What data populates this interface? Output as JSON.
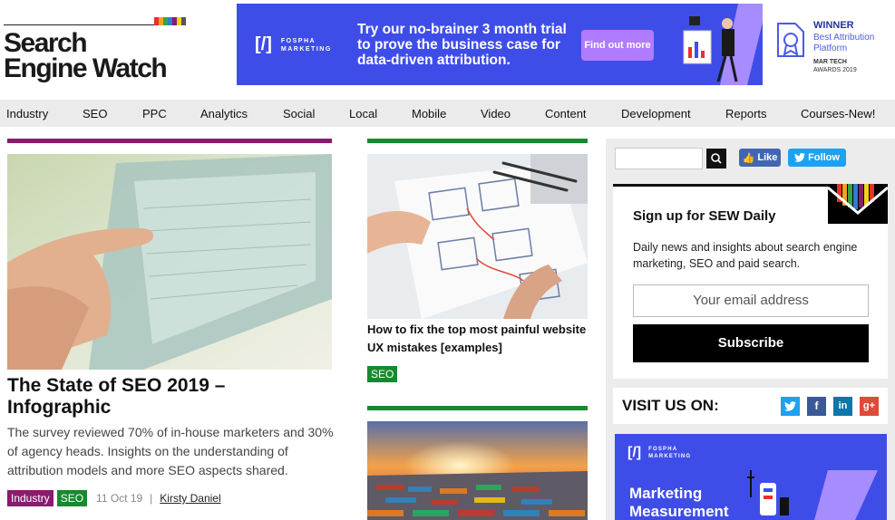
{
  "logo": {
    "line1": "Search",
    "line2": "Engine Watch",
    "stripe_colors": [
      "#e8302d",
      "#f0a21c",
      "#36a34a",
      "#2a7fd0",
      "#8a1b6e",
      "#f2d21a",
      "#555555"
    ]
  },
  "banner": {
    "brand_mark": "[/]",
    "brand_line1": "FOSPHA",
    "brand_line2": "MARKETING",
    "headline": "Try our no-brainer 3 month trial to prove the business case for data-driven attribution.",
    "cta": "Find out more",
    "award_title": "WINNER",
    "award_subtitle": "Best Attribution Platform",
    "award_org_line1": "MAR TECH",
    "award_org_line2": "AWARDS 2019"
  },
  "nav": [
    "Industry",
    "SEO",
    "PPC",
    "Analytics",
    "Social",
    "Local",
    "Mobile",
    "Video",
    "Content",
    "Development",
    "Reports",
    "Courses-New!"
  ],
  "hero": {
    "title": "The State of SEO 2019 – Infographic",
    "description": "The survey reviewed 70% of in-house marketers and 30% of agency heads. Insights on the understanding of attribution models and more SEO aspects shared.",
    "tags": [
      "Industry",
      "SEO"
    ],
    "date": "11 Oct 19",
    "separator": "|",
    "author": "Kirsty Daniel"
  },
  "mid": {
    "title": "How to fix the top most painful website UX mistakes [examples]",
    "tag": "SEO"
  },
  "social": {
    "fb_label": "Like",
    "tw_label": "Follow"
  },
  "signup": {
    "title": "Sign up for SEW Daily",
    "description": "Daily news and insights about search engine marketing, SEO and paid search.",
    "email_placeholder": "Your email address",
    "button": "Subscribe"
  },
  "visit": {
    "label": "VISIT US ON:",
    "icons": [
      "t",
      "f",
      "in",
      "g+"
    ]
  },
  "ad2": {
    "brand_mark": "[/]",
    "brand_line1": "FOSPHA",
    "brand_line2": "MARKETING",
    "headline_line1": "Marketing",
    "headline_line2": "Measurement"
  }
}
